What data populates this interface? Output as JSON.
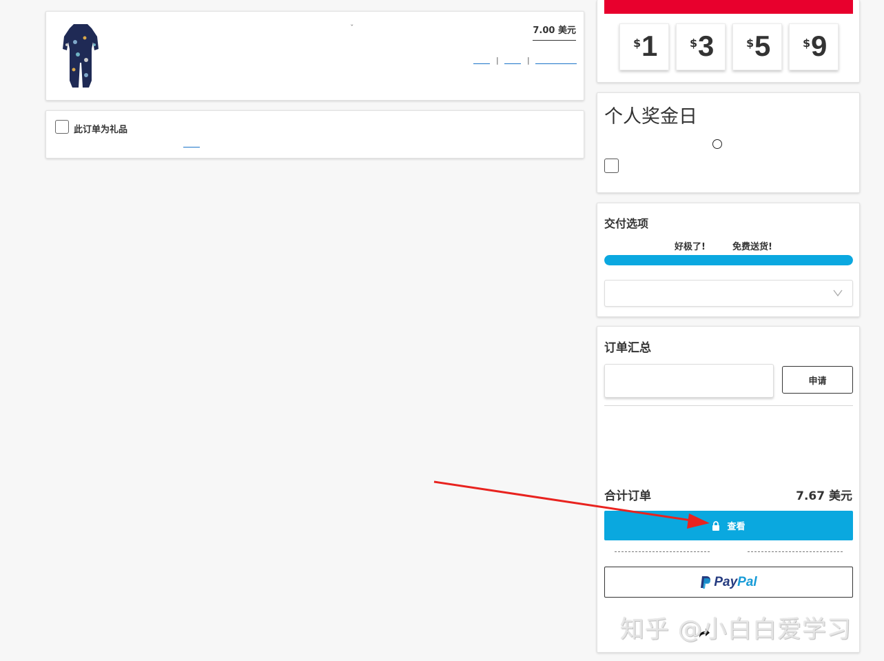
{
  "product": {
    "price": "7.00 美元",
    "qty_chevron": "ˇ",
    "separator": "|"
  },
  "gift": {
    "label": "此订单为礼品"
  },
  "roundup": {
    "currency_symbol": "$",
    "amounts": [
      "1",
      "3",
      "5",
      "9"
    ],
    "banner_color": "#e8002d"
  },
  "bonus": {
    "title": "个人奖金日"
  },
  "delivery": {
    "title": "交付选项",
    "great": "好极了!",
    "free_shipping": "免费送货!",
    "progress_fraction": 1.0,
    "progress_color": "#0ba8e0"
  },
  "summary": {
    "title": "订单汇总",
    "promo_placeholder": "",
    "apply_label": "申请",
    "total_label": "合计订单",
    "total_value": "7.67 美元",
    "checkout_label": "查看",
    "checkout_color": "#0aa8df",
    "paypal_pay": "Pay",
    "paypal_pal": "Pal"
  },
  "watermark": {
    "text": "知乎 @小白白爱学习"
  },
  "icons": {
    "lock": "lock-icon",
    "paypal_logo": "paypal-logo-icon",
    "share": "share-icon",
    "chevron": "chevron-down-icon"
  }
}
